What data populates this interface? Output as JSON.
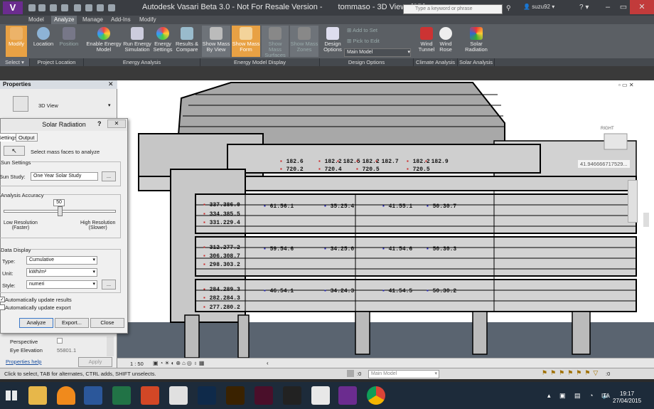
{
  "window": {
    "title": "Autodesk Vasari Beta 3.0 - Not For Resale Version -",
    "project": "tommaso - 3D View: {3D}",
    "search_placeholder": "Type a keyword or phrase",
    "user": "suzu92"
  },
  "tabs": [
    "Model",
    "Analyze",
    "Manage",
    "Add-Ins",
    "Modify"
  ],
  "ribbon": {
    "modify": "Modify",
    "location": "Location",
    "position": "Position",
    "enable_energy": "Enable Energy\nModel",
    "run_energy": "Run Energy\nSimulation",
    "energy_settings": "Energy\nSettings",
    "results_compare": "Results &\nCompare",
    "show_mass_view": "Show Mass\nBy View",
    "show_mass_form": "Show Mass\nForm",
    "show_mass_surfaces": "Show Mass\nSurfaces",
    "show_mass_zones": "Show Mass\nZones",
    "design_options": "Design\nOptions",
    "add_to_set": "Add to Set",
    "pick_to_edit": "Pick to Edit",
    "main_model": "Main Model",
    "wind_tunnel": "Wind\nTunnel",
    "wind_rose": "Wind\nRose",
    "solar_radiation": "Solar\nRadiation"
  },
  "panels": [
    "Select ▾",
    "Project Location",
    "Energy Analysis",
    "Energy Model Display",
    "Design Options",
    "Climate Analysis",
    "Solar Analysis"
  ],
  "properties": {
    "header": "Properties",
    "view_type": "3D View",
    "perspective_label": "Perspective",
    "eye_elev_label": "Eye Elevation",
    "eye_elev_value": "55801.1",
    "help": "Properties help",
    "apply": "Apply"
  },
  "dialog": {
    "title": "Solar Radiation",
    "tab_settings": "Settings",
    "tab_output": "Output",
    "select_faces": "Select mass faces to analyze",
    "sun_settings": "Sun Settings",
    "sun_study_label": "Sun Study:",
    "sun_study_value": "One Year Solar Study",
    "accuracy": "Analysis Accuracy",
    "accuracy_value": "50",
    "accuracy_fraction": 0.5,
    "low_res": "Low Resolution\n(Faster)",
    "high_res": "High Resolution\n(Slower)",
    "data_display": "Data Display",
    "type_label": "Type:",
    "type_value": "Cumulative",
    "unit_label": "Unit:",
    "unit_value": "kWh/m²",
    "style_label": "Style:",
    "style_value": "numeri",
    "auto_update": "Automatically update results",
    "auto_export": "Automatically update export",
    "analyze": "Analyze",
    "export": "Export...",
    "close": "Close",
    "browse": "..."
  },
  "viewport": {
    "coord": "41.946666717529...",
    "cube_label": "RIGHT"
  },
  "values": [
    {
      "t": "182.6",
      "c": "red"
    },
    {
      "t": "720.2",
      "c": "red"
    },
    {
      "t": "182.2",
      "c": "red"
    },
    {
      "t": "182.5",
      "c": "red"
    },
    {
      "t": "720.4",
      "c": "red"
    },
    {
      "t": "182.2",
      "c": "red"
    },
    {
      "t": "182.7",
      "c": "red"
    },
    {
      "t": "720.5",
      "c": "red"
    },
    {
      "t": "182.2",
      "c": "red"
    },
    {
      "t": "182.9",
      "c": "red"
    },
    {
      "t": "720.5",
      "c": "red"
    },
    {
      "t": "337.386.0",
      "c": "red"
    },
    {
      "t": "334.385.5",
      "c": "red"
    },
    {
      "t": "331.229.4",
      "c": "red"
    },
    {
      "t": "61.56.1",
      "c": "blue"
    },
    {
      "t": "35.25.4",
      "c": "blue"
    },
    {
      "t": "41.55.1",
      "c": "blue"
    },
    {
      "t": "50.30.7",
      "c": "blue"
    },
    {
      "t": "312.277.2",
      "c": "red"
    },
    {
      "t": "306.308.7",
      "c": "red"
    },
    {
      "t": "298.303.2",
      "c": "red"
    },
    {
      "t": "59.54.6",
      "c": "blue"
    },
    {
      "t": "34.25.0",
      "c": "blue"
    },
    {
      "t": "41.54.6",
      "c": "blue"
    },
    {
      "t": "50.30.3",
      "c": "blue"
    },
    {
      "t": "284.289.3",
      "c": "red"
    },
    {
      "t": "282.284.3",
      "c": "red"
    },
    {
      "t": "277.280.2",
      "c": "red"
    },
    {
      "t": "46.54.1",
      "c": "blue"
    },
    {
      "t": "34.24.3",
      "c": "blue"
    },
    {
      "t": "41.54.5",
      "c": "blue"
    },
    {
      "t": "50.30.2",
      "c": "blue"
    }
  ],
  "viewctrl": {
    "scale": "1 : 50",
    "main_model": "Main Model"
  },
  "status": {
    "hint": "Click to select, TAB for alternates, CTRL adds, SHIFT unselects.",
    "zero": ":0"
  },
  "clock": {
    "time": "19:17",
    "date": "27/04/2015",
    "lang": "ITA"
  },
  "colors": {
    "accent": "#e8a144",
    "title_bg": "#3a3d42",
    "ribbon_bg": "#5b5f64",
    "label_red": "#cc2222",
    "label_blue": "#2222bb"
  }
}
